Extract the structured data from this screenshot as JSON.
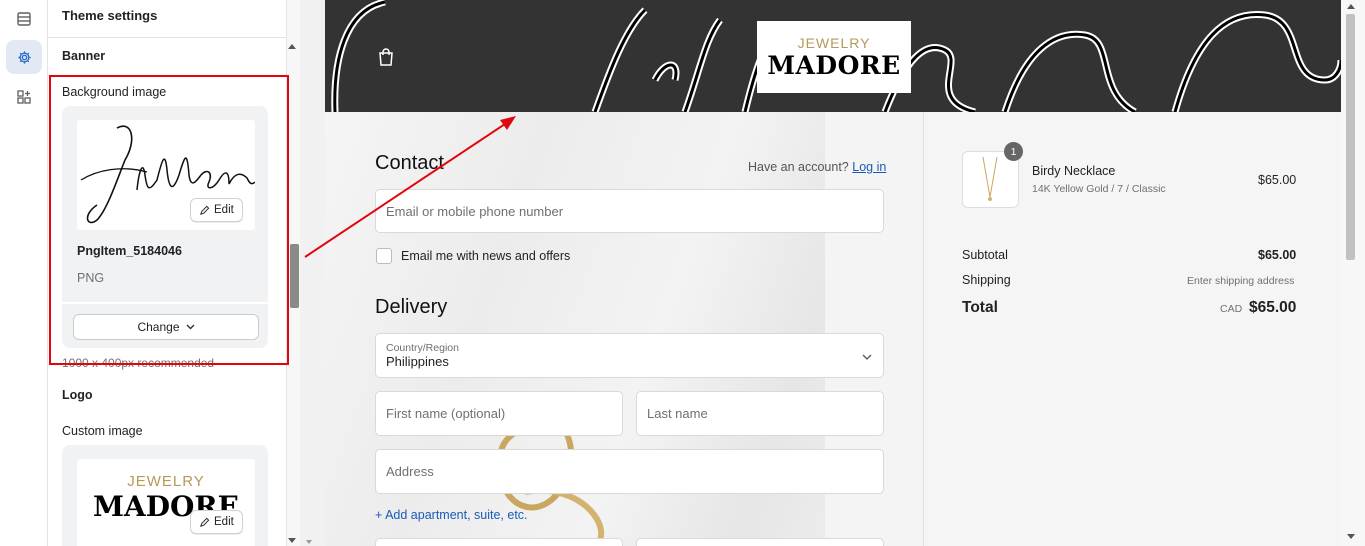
{
  "sidebar_rail": {
    "items": [
      "sections-icon",
      "settings-icon",
      "apps-icon"
    ]
  },
  "panel": {
    "title": "Theme settings",
    "banner_heading": "Banner",
    "background_image_label": "Background image",
    "bg_file_name": "PngItem_5184046",
    "bg_file_type": "PNG",
    "bg_preview_text": "Jillian",
    "edit_label": "Edit",
    "change_label": "Change",
    "recommend_text": "1000 x 400px recommended",
    "logo_heading": "Logo",
    "custom_image_label": "Custom image",
    "logo_preview_top": "JEWELRY",
    "logo_preview_bottom": "MADORE"
  },
  "preview": {
    "banner_text": "Jillian",
    "logo_top": "JEWELRY",
    "logo_bottom": "MADORE",
    "contact_heading": "Contact",
    "have_account": "Have an account?",
    "login_link": "Log in",
    "email_placeholder": "Email or mobile phone number",
    "newsletter_label": "Email me with news and offers",
    "delivery_heading": "Delivery",
    "country_label": "Country/Region",
    "country_value": "Philippines",
    "first_name_placeholder": "First name (optional)",
    "last_name_placeholder": "Last name",
    "address_placeholder": "Address",
    "add_apartment": "+ Add apartment, suite, etc."
  },
  "summary": {
    "item_qty": "1",
    "item_name": "Birdy Necklace",
    "item_variant": "14K Yellow Gold / 7 / Classic",
    "item_price": "$65.00",
    "subtotal_label": "Subtotal",
    "subtotal_value": "$65.00",
    "shipping_label": "Shipping",
    "shipping_value": "Enter shipping address",
    "total_label": "Total",
    "total_currency": "CAD",
    "total_value": "$65.00"
  },
  "colors": {
    "annotation": "#e0070c",
    "link": "#1a5bb8",
    "banner": "#333333",
    "logo_gold": "#b49a5a"
  }
}
